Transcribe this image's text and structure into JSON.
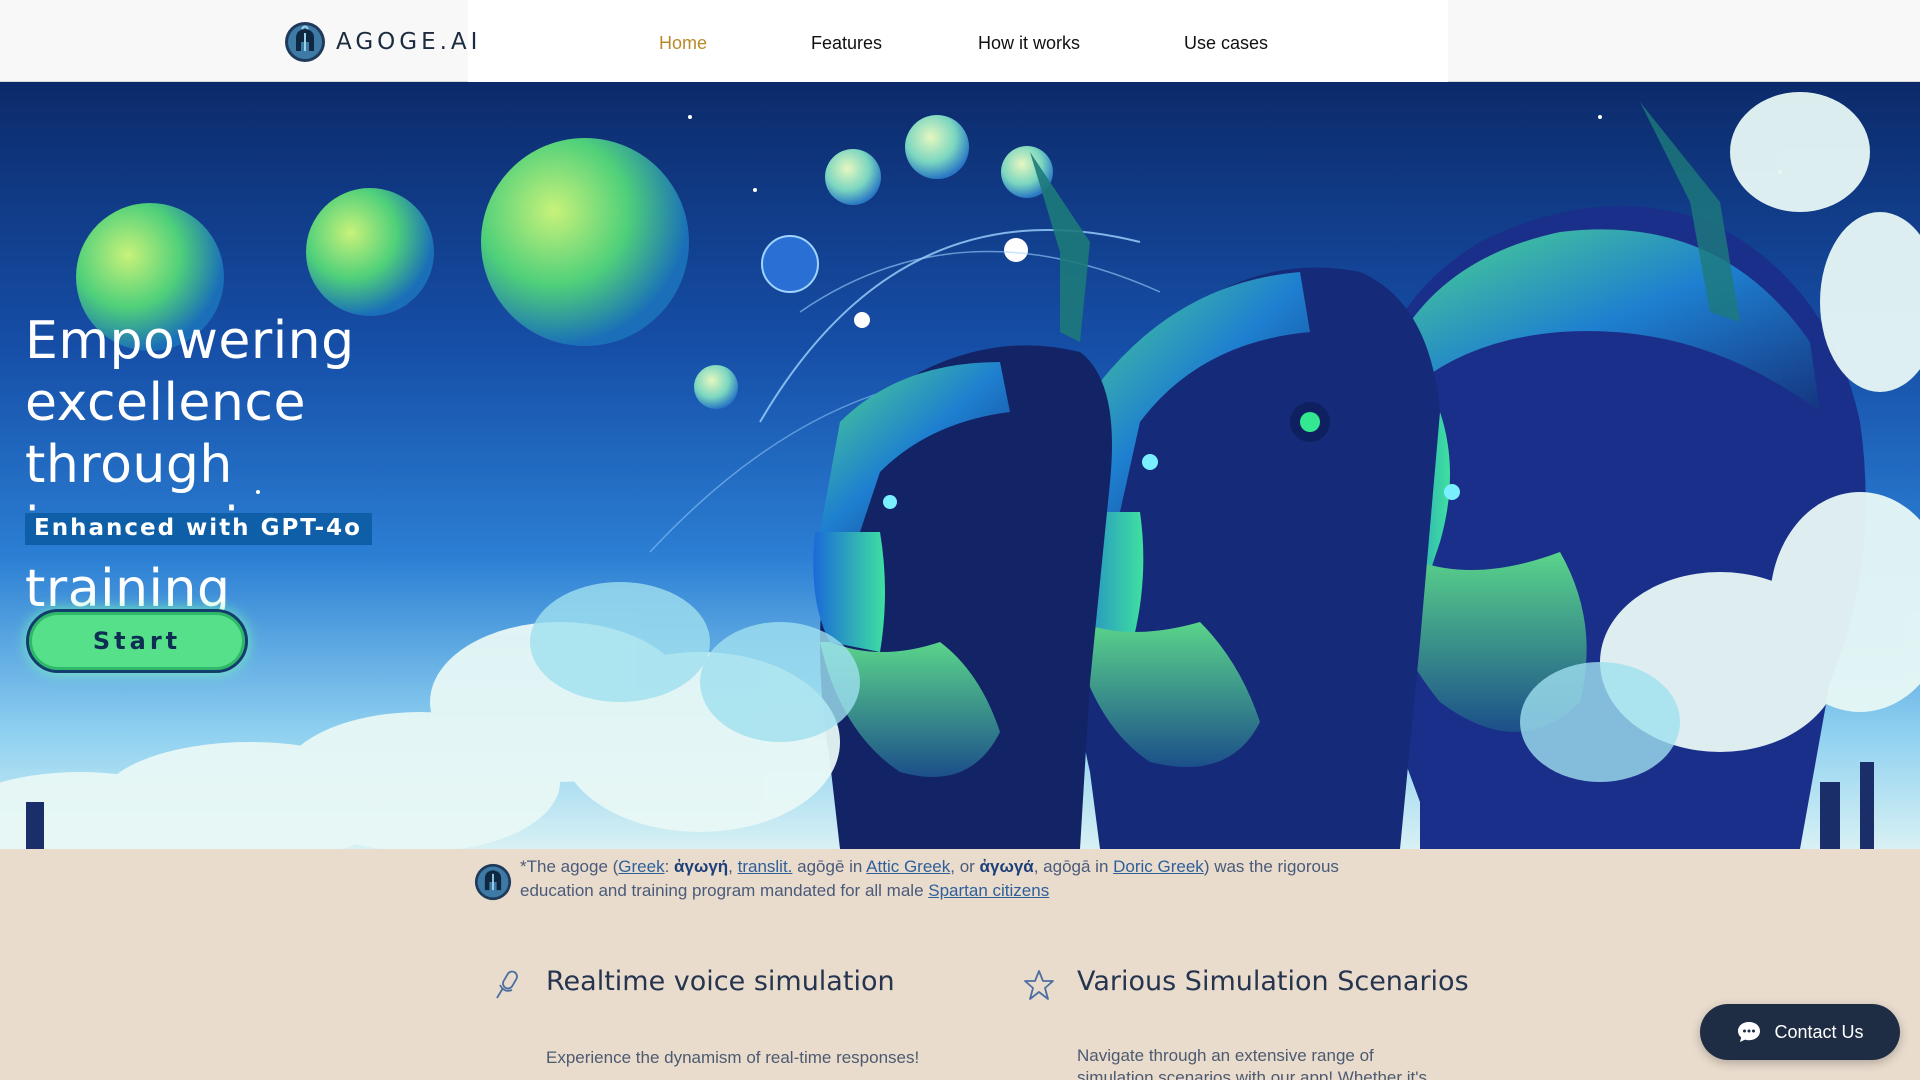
{
  "brand": {
    "name": "AGOGE.AI",
    "logo_icon": "spartan-helmet-icon"
  },
  "nav": {
    "items": [
      {
        "label": "Home",
        "active": true
      },
      {
        "label": "Features",
        "active": false
      },
      {
        "label": "How it works",
        "active": false
      },
      {
        "label": "Use cases",
        "active": false
      }
    ]
  },
  "hero": {
    "title": "Empowering excellence through immersive training",
    "badge": "Enhanced with GPT-4o",
    "cta": "Start",
    "art": "spartan-warriors-illustration"
  },
  "note": {
    "icon": "spartan-helmet-icon",
    "prefix": "*The agoge (",
    "link_greek": "Greek",
    "colon": ": ",
    "greek_1": "ἀγωγή",
    "sep_1": ", ",
    "link_translit": "translit.",
    "mid_1": " agōgē in ",
    "link_attic": "Attic Greek",
    "mid_2": ", or ",
    "greek_2": "ἀγωγά",
    "mid_3": ", agōgā in ",
    "link_doric": "Doric Greek",
    "mid_4": ") was the rigorous education and training program mandated for all male ",
    "link_spartan": "Spartan citizens"
  },
  "features": [
    {
      "icon": "microphone-icon",
      "title": "Realtime voice simulation",
      "desc_1": "Experience the dynamism of real-time responses!",
      "desc_2": ""
    },
    {
      "icon": "star-icon",
      "title": "Various Simulation Scenarios",
      "desc_1": "Navigate through an extensive range of",
      "desc_2": "simulation scenarios with our app! Whether it's"
    }
  ],
  "contact": {
    "label": "Contact Us",
    "icon": "chat-bubble-icon"
  },
  "colors": {
    "accent_nav": "#b98a2a",
    "start_button": "#56e08a",
    "badge": "#0f5fa8",
    "footer_bg": "#e9dccd"
  }
}
